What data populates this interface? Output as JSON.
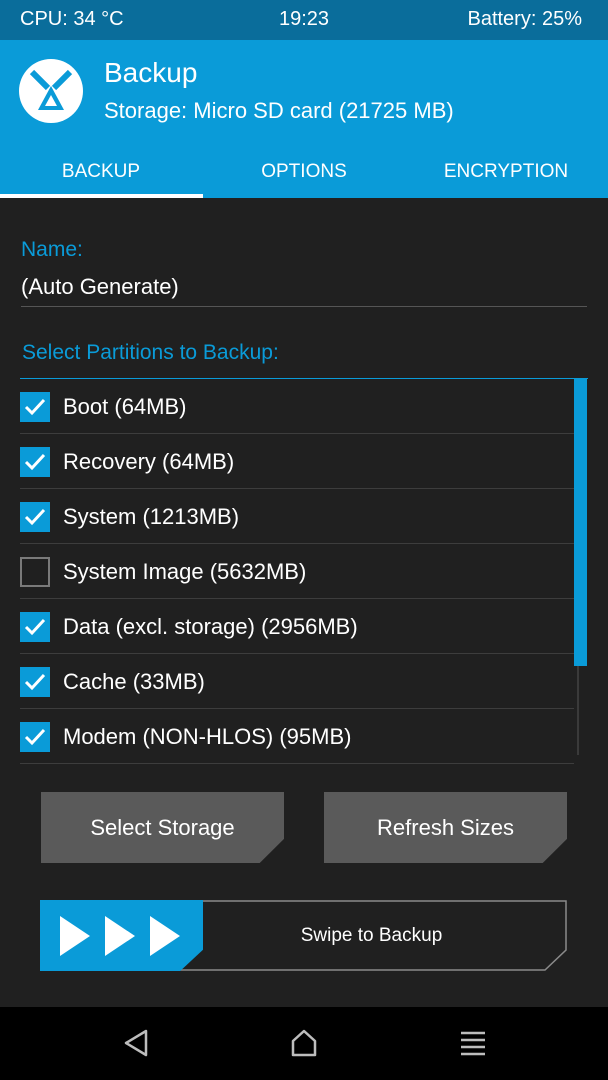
{
  "status_bar": {
    "cpu": "CPU: 34 °C",
    "time": "19:23",
    "battery": "Battery: 25%"
  },
  "header": {
    "title": "Backup",
    "subtitle": "Storage: Micro SD card (21725 MB)"
  },
  "tabs": [
    {
      "label": "BACKUP",
      "active": true
    },
    {
      "label": "OPTIONS",
      "active": false
    },
    {
      "label": "ENCRYPTION",
      "active": false
    }
  ],
  "name_field": {
    "label": "Name:",
    "value": "(Auto Generate)"
  },
  "partitions": {
    "label": "Select Partitions to Backup:",
    "items": [
      {
        "label": "Boot (64MB)",
        "checked": true
      },
      {
        "label": "Recovery (64MB)",
        "checked": true
      },
      {
        "label": "System (1213MB)",
        "checked": true
      },
      {
        "label": "System Image (5632MB)",
        "checked": false
      },
      {
        "label": "Data (excl. storage) (2956MB)",
        "checked": true
      },
      {
        "label": "Cache (33MB)",
        "checked": true
      },
      {
        "label": "Modem (NON-HLOS) (95MB)",
        "checked": true
      }
    ]
  },
  "buttons": {
    "select_storage": "Select Storage",
    "refresh_sizes": "Refresh Sizes"
  },
  "swipe": {
    "label": "Swipe to Backup"
  },
  "colors": {
    "accent": "#0a9bd8",
    "status_bar": "#0a6d9b",
    "background": "#202020",
    "button": "#5a5a5a"
  }
}
